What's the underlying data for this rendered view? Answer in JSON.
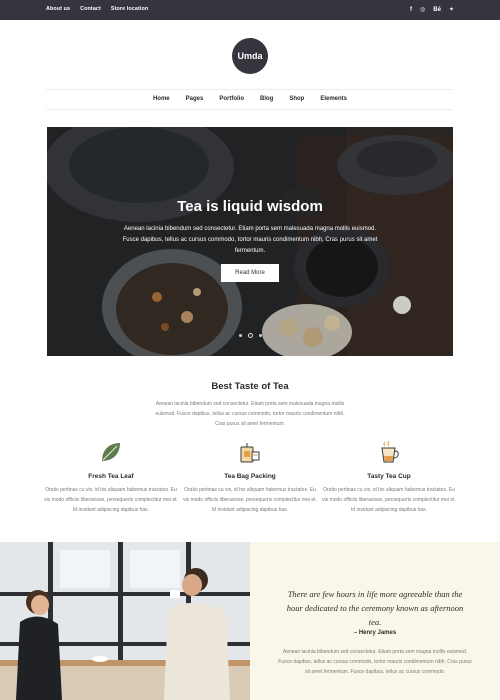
{
  "topbar": {
    "links": [
      "About us",
      "Contact",
      "Store location"
    ],
    "social": [
      {
        "icon": "facebook-icon",
        "glyph": "f"
      },
      {
        "icon": "instagram-icon",
        "glyph": "◎"
      },
      {
        "icon": "behance-icon",
        "glyph": "Bē"
      },
      {
        "icon": "twitter-icon",
        "glyph": "✦"
      }
    ]
  },
  "logo": {
    "text": "Umda"
  },
  "nav": {
    "items": [
      "Home",
      "Pages",
      "Portfolio",
      "Blog",
      "Shop",
      "Elements"
    ]
  },
  "hero": {
    "title": "Tea is liquid wisdom",
    "text": "Aenean lacinia bibendum sed consectetur. Etiam porta sem malesuada magna mollis euismod. Fusce dapibus, tellus ac cursus commodo, tortor mauris condimentum nibh, Cras purus sit amet fermentum.",
    "button": "Read More"
  },
  "taste": {
    "title": "Best Taste of Tea",
    "text": "Aenean lacinia bibendum sed consectetur. Etiam porta sem malesuada magna mollis euismod. Fusce dapibus, tellus ac cursus commodo, tortor mauris condimentum nibh, Cras purus sit amet fermentum.",
    "features": [
      {
        "title": "Fresh Tea Leaf",
        "icon": "tea-leaf-icon",
        "text": "Oratio pertinax cu vix, id his aliquam habemus tractatos. Eu vis modo officiis liberavisse, persequeris complectitur mei et. Id invidunt adipiscing dapibus has."
      },
      {
        "title": "Tea Bag Packing",
        "icon": "tea-bag-icon",
        "text": "Oratio pertinax cu vix, id his aliquam habemus tractatos. Eu vis modo officiis liberavisse, persequeris complectitur mei et. Id invidunt adipiscing dapibus has."
      },
      {
        "title": "Tasty Tea Cup",
        "icon": "tea-cup-icon",
        "text": "Oratio pertinax cu vix, id his aliquam habemus tractatos. Eu vis modo officiis liberavisse, persequeris complectitur mei et. Id invidunt adipiscing dapibus has."
      }
    ]
  },
  "quote": {
    "text": "There are few hours in life more agreeable than the hour dedicated to the ceremony known as afternoon tea.",
    "author": "– Henry James",
    "body": "Aenean lacinia bibendum sed consectetur. Etiam porta sem magna mollis euismod. Fusce dapibus, tellus ac cursus commodo, tortor mauris condimentum nibh, Cras purus sit amet fermentum. Fusce dapibus, tellus ac cursus commodo."
  },
  "colors": {
    "dark": "#34353d",
    "cream": "#faf7ea",
    "leaf": "#5f7d4c",
    "accent": "#e2a04a"
  }
}
